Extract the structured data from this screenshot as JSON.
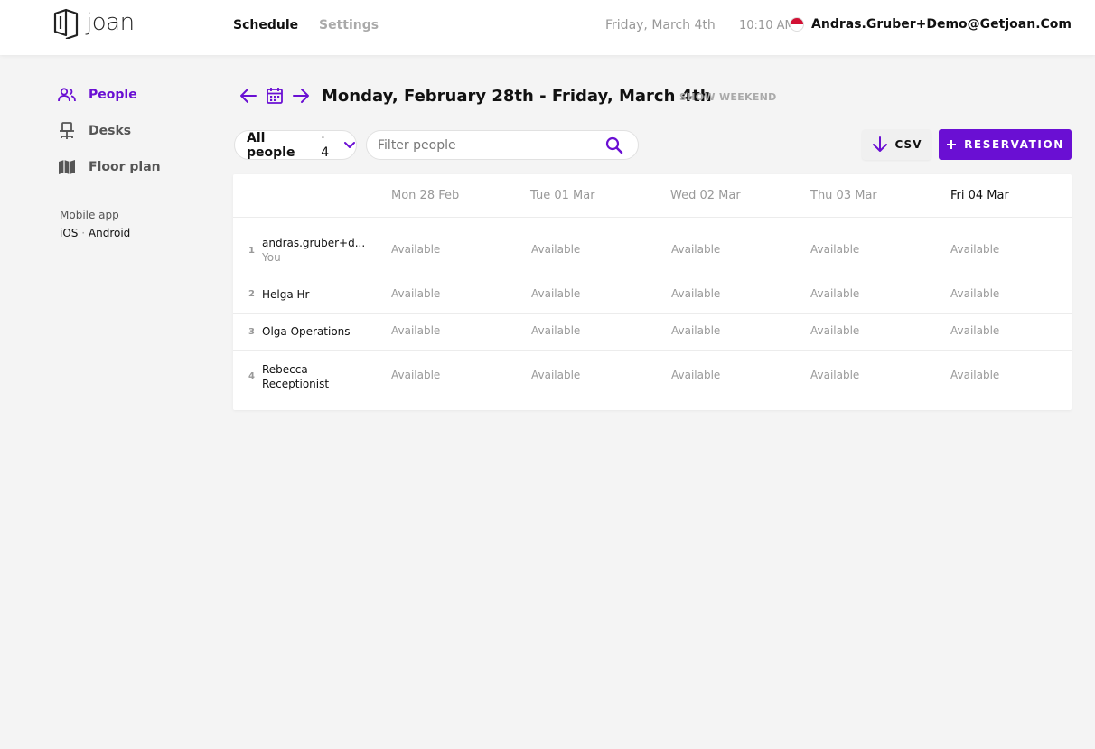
{
  "header": {
    "logo_text": "joan",
    "nav": {
      "schedule": "Schedule",
      "settings": "Settings"
    },
    "date": "Friday, March 4th",
    "time": "10:10 AM",
    "user_email": "Andras.Gruber+Demo@Getjoan.Com"
  },
  "sidebar": {
    "items": [
      {
        "label": "People",
        "icon": "people-icon"
      },
      {
        "label": "Desks",
        "icon": "desk-chair-icon"
      },
      {
        "label": "Floor plan",
        "icon": "map-icon"
      }
    ],
    "mobile_label": "Mobile app",
    "ios": "iOS",
    "separator": "·",
    "android": "Android"
  },
  "schedule": {
    "title": "Monday, February 28th - Friday, March 4th",
    "show_weekend": "SHOW WEEKEND",
    "people_filter": {
      "label": "All people",
      "count": "· 4"
    },
    "filter_placeholder": "Filter people",
    "csv_label": "CSV",
    "reservation_label": "RESERVATION",
    "accent_color": "#6a0fd3"
  },
  "table": {
    "columns": [
      "Mon 28 Feb",
      "Tue 01 Mar",
      "Wed 02 Mar",
      "Thu 03 Mar",
      "Fri 04 Mar"
    ],
    "rows": [
      {
        "num": "1",
        "name": "andras.gruber+d...",
        "sub": "You",
        "cells": [
          "Available",
          "Available",
          "Available",
          "Available",
          "Available"
        ]
      },
      {
        "num": "2",
        "name": "Helga Hr",
        "sub": "",
        "cells": [
          "Available",
          "Available",
          "Available",
          "Available",
          "Available"
        ]
      },
      {
        "num": "3",
        "name": "Olga Operations",
        "sub": "",
        "cells": [
          "Available",
          "Available",
          "Available",
          "Available",
          "Available"
        ]
      },
      {
        "num": "4",
        "name": "Rebecca Receptionist",
        "sub": "",
        "cells": [
          "Available",
          "Available",
          "Available",
          "Available",
          "Available"
        ]
      }
    ]
  }
}
